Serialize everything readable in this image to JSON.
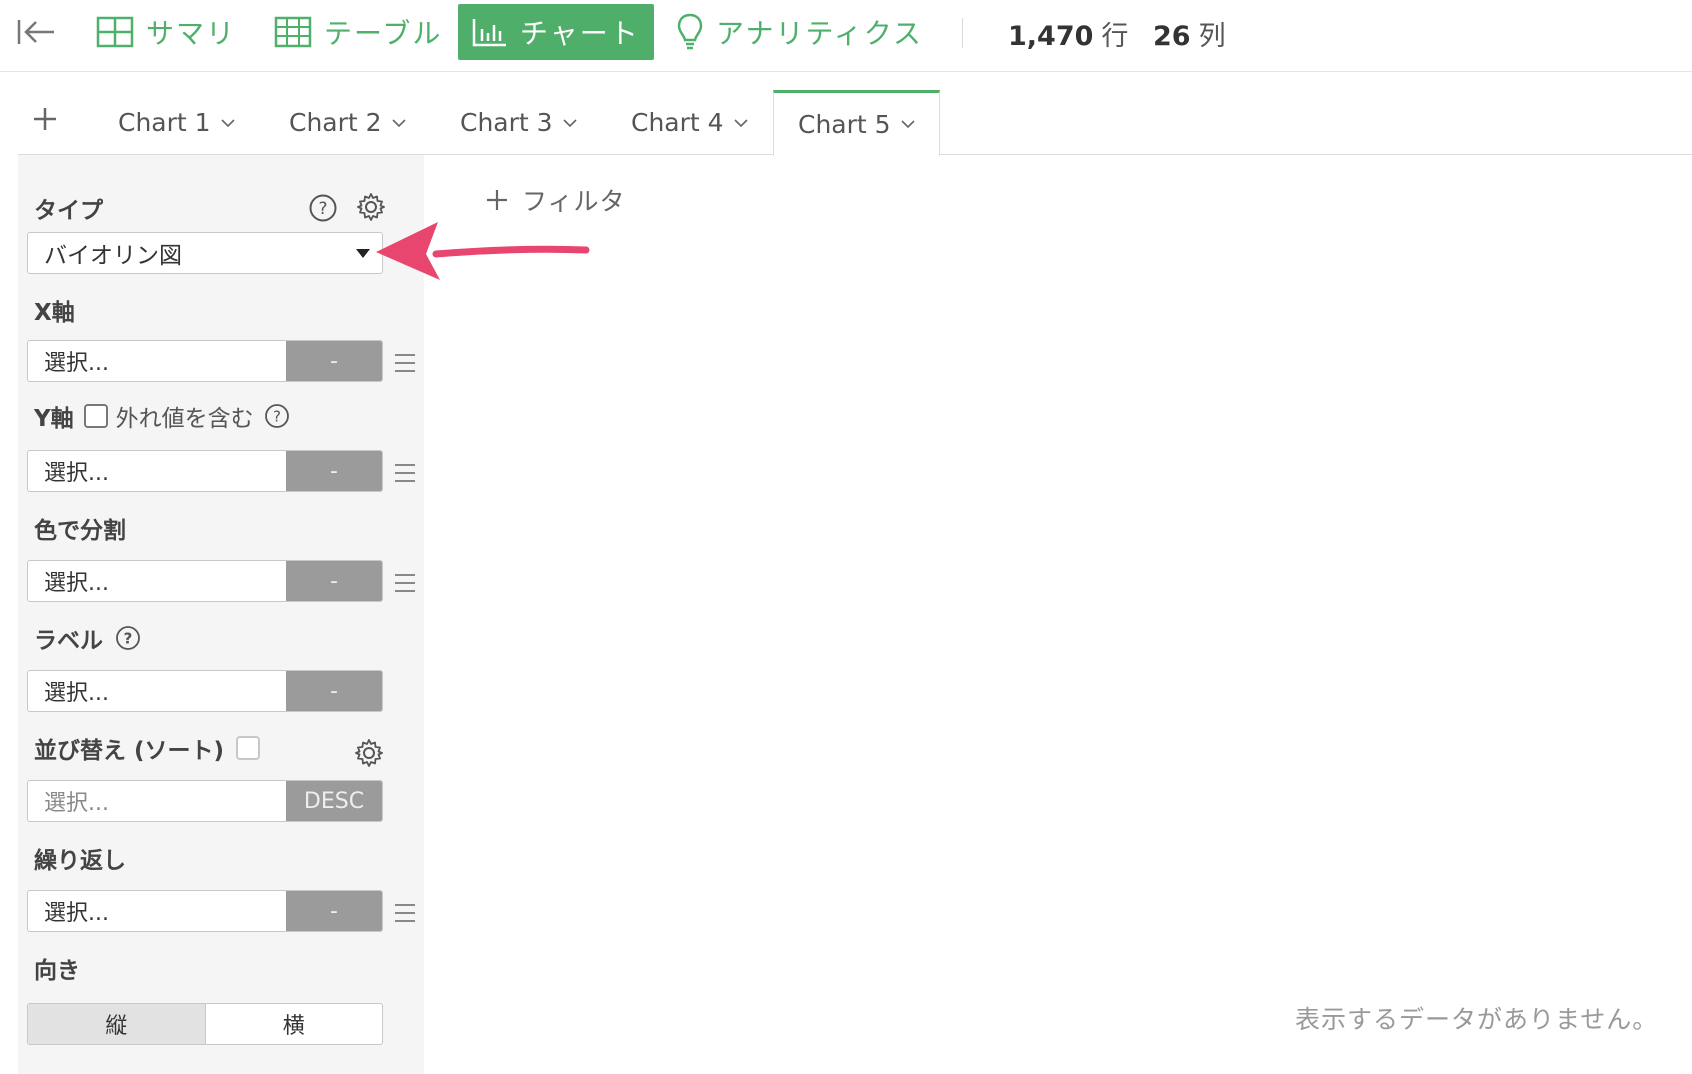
{
  "toolbar": {
    "summary_label": "サマリ",
    "table_label": "テーブル",
    "chart_label": "チャート",
    "analytics_label": "アナリティクス",
    "rows_count": "1,470",
    "rows_unit": "行",
    "cols_count": "26",
    "cols_unit": "列"
  },
  "tabs": [
    {
      "label": "Chart 1"
    },
    {
      "label": "Chart 2"
    },
    {
      "label": "Chart 3"
    },
    {
      "label": "Chart 4"
    },
    {
      "label": "Chart 5",
      "active": true
    }
  ],
  "panel": {
    "type_label": "タイプ",
    "type_value": "バイオリン図",
    "x_label": "X軸",
    "x_value": "選択...",
    "x_btn": "-",
    "y_label": "Y軸",
    "y_outlier": "外れ値を含む",
    "y_value": "選択...",
    "y_btn": "-",
    "color_label": "色で分割",
    "color_value": "選択...",
    "color_btn": "-",
    "label_label": "ラベル",
    "label_value": "選択...",
    "label_btn": "-",
    "sort_label": "並び替え (ソート)",
    "sort_value": "選択...",
    "sort_btn": "DESC",
    "repeat_label": "繰り返し",
    "repeat_value": "選択...",
    "repeat_btn": "-",
    "orient_label": "向き",
    "orient_vertical": "縦",
    "orient_horizontal": "横"
  },
  "main": {
    "filter_label": "フィルタ",
    "no_data": "表示するデータがありません。"
  },
  "colors": {
    "accent": "#4fae6a",
    "arrow": "#e8466e"
  }
}
